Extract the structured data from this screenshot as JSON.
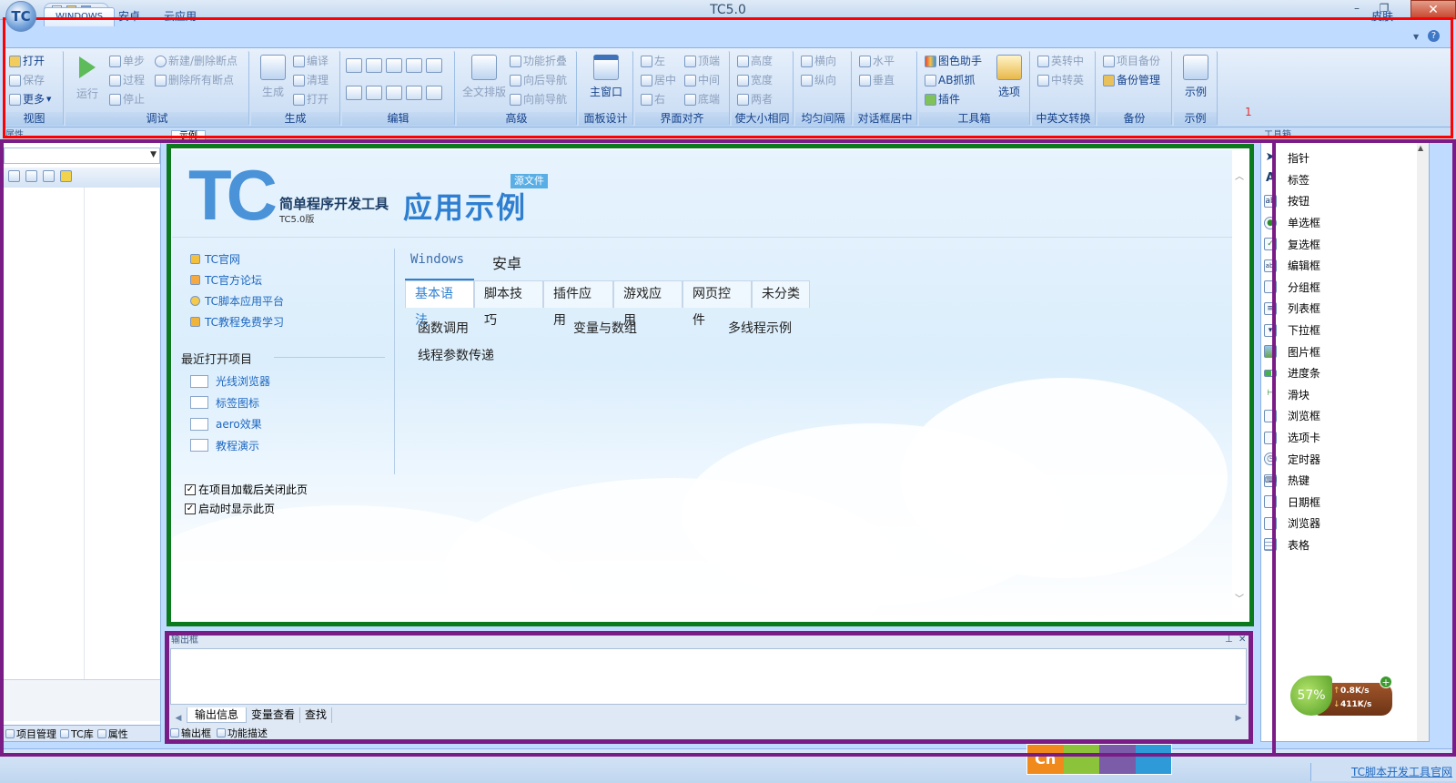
{
  "window": {
    "title": "TC5.0",
    "orb": "TC",
    "min": "–",
    "max": "❐",
    "close": "✕"
  },
  "ribbon": {
    "tabs": [
      "WINDOWS",
      "安卓",
      "云应用"
    ],
    "skin_label": "皮肤",
    "help_icon": "?",
    "marker": "1",
    "groups": {
      "view": {
        "title": "视图",
        "open": "打开",
        "save": "保存",
        "more": "更多"
      },
      "debug": {
        "title": "调试",
        "run": "运行",
        "step": "单步",
        "process": "过程",
        "stop": "停止",
        "new_breakpoint": "新建/删除断点",
        "delete_breakpoints": "删除所有断点"
      },
      "build": {
        "title": "生成",
        "build": "生成",
        "compile": "编译",
        "clean": "清理",
        "open": "打开"
      },
      "edit": {
        "title": "编辑"
      },
      "advanced": {
        "title": "高级",
        "full_layout": "全文排版",
        "fold": "功能折叠",
        "back_nav": "向后导航",
        "fwd_nav": "向前导航"
      },
      "panel": {
        "title": "面板设计",
        "main_window": "主窗口"
      },
      "align": {
        "title": "界面对齐",
        "left": "左",
        "center": "居中",
        "right": "右",
        "top": "顶端",
        "middle": "中间",
        "bottom": "底端"
      },
      "size": {
        "title": "使大小相同",
        "height": "高度",
        "width": "宽度",
        "both": "两者"
      },
      "spacing": {
        "title": "均匀间隔",
        "horizontal": "横向",
        "vertical": "纵向"
      },
      "dialog_center": {
        "title": "对话框居中",
        "horizontal": "水平",
        "vertical": "垂直"
      },
      "toolbox": {
        "title": "工具箱",
        "color_helper": "图色助手",
        "ab_grab": "AB抓抓",
        "plugin": "插件",
        "options": "选项"
      },
      "convert": {
        "title": "中英文转换",
        "en_to_cn": "英转中",
        "cn_to_en": "中转英"
      },
      "backup": {
        "title": "备份",
        "project_backup": "项目备份",
        "backup_manage": "备份管理"
      },
      "example": {
        "title": "示例",
        "example": "示例"
      }
    }
  },
  "left_panel": {
    "title": "属性",
    "tabs": [
      "项目管理",
      "TC库",
      "属性"
    ]
  },
  "document": {
    "tab": "示例"
  },
  "start_page": {
    "logo": "TC",
    "logo_sub": "简单程序开发工具",
    "logo_ver": "TC5.0版",
    "heading": "应用示例",
    "source_badge": "源文件",
    "links": [
      "TC官网",
      "TC官方论坛",
      "TC脚本应用平台",
      "TC教程免费学习"
    ],
    "recent_title": "最近打开项目",
    "recent": [
      "光线浏览器",
      "标签图标",
      "aero效果",
      "教程演示"
    ],
    "checkboxes": [
      "在项目加载后关闭此页",
      "启动时显示此页"
    ],
    "platform_tabs": [
      "Windows",
      "安卓"
    ],
    "category_tabs": [
      "基本语法",
      "脚本技巧",
      "插件应用",
      "游戏应用",
      "网页控件",
      "未分类"
    ],
    "examples": [
      "函数调用",
      "变量与数组",
      "多线程示例",
      "线程参数传递"
    ]
  },
  "output": {
    "title": "输出框",
    "tabs": [
      "输出信息",
      "变量查看",
      "查找"
    ],
    "bottom_tabs": [
      "输出框",
      "功能描述"
    ]
  },
  "toolbox": {
    "title": "工具箱",
    "items": [
      "指针",
      "标签",
      "按钮",
      "单选框",
      "复选框",
      "编辑框",
      "分组框",
      "列表框",
      "下拉框",
      "图片框",
      "进度条",
      "滑块",
      "浏览框",
      "选项卡",
      "定时器",
      "热键",
      "日期框",
      "浏览器",
      "表格"
    ]
  },
  "network_widget": {
    "percent": "57%",
    "upload": "0.8K/s",
    "download": "411K/s"
  },
  "ime": {
    "label": "Ch"
  },
  "status_bar": {
    "link": "TC脚本开发工具官网"
  },
  "colors": {
    "ribbon_highlight": "#ff0000",
    "document_highlight": "#0a7a1d",
    "panel_highlight": "#7a1c86"
  }
}
